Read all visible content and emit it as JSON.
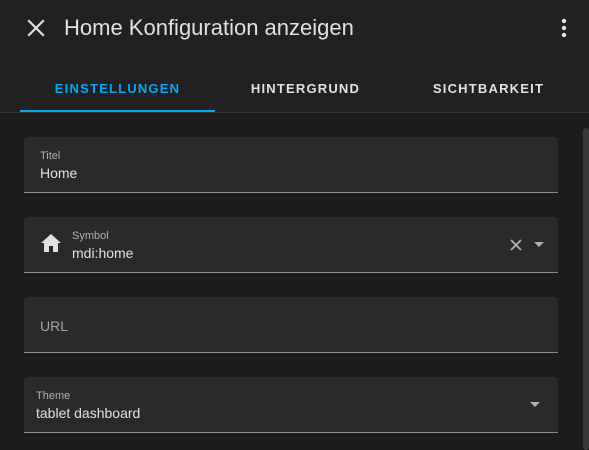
{
  "dialog": {
    "title": "Home Konfiguration anzeigen",
    "close_icon": "close-icon",
    "menu_icon": "dots-vertical-icon"
  },
  "tabs": [
    {
      "label": "EINSTELLUNGEN",
      "active": true
    },
    {
      "label": "HINTERGRUND",
      "active": false
    },
    {
      "label": "SICHTBARKEIT",
      "active": false
    }
  ],
  "form": {
    "title_field": {
      "label": "Titel",
      "value": "Home"
    },
    "icon_field": {
      "label": "Symbol",
      "value": "mdi:home",
      "prefix_icon": "home-icon"
    },
    "url_field": {
      "placeholder": "URL",
      "value": ""
    },
    "theme_field": {
      "label": "Theme",
      "value": "tablet dashboard"
    }
  },
  "colors": {
    "accent": "#03a9f4",
    "background": "#1c1c1c",
    "surface": "#2a2a2a",
    "text": "#e1e1e1"
  }
}
